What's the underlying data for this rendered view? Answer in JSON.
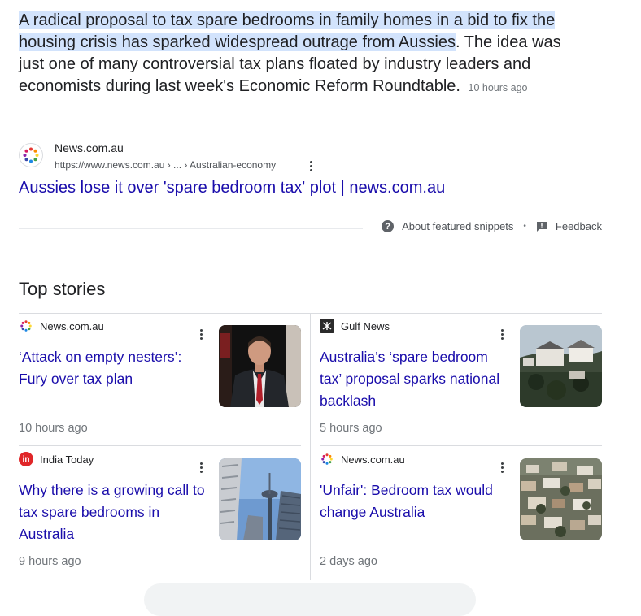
{
  "snippet": {
    "highlighted": "A radical proposal to tax spare bedrooms in family homes in a bid to fix the housing crisis has sparked widespread outrage from Aussies",
    "rest": ". The idea was just one of many controversial tax plans floated by industry leaders and economists during last week's Economic Reform Roundtable.",
    "time": "10 hours ago"
  },
  "source": {
    "name": "News.com.au",
    "url": "https://www.news.com.au › ... › Australian-economy",
    "icon": "newscomau-dots-icon"
  },
  "result_link": "Aussies lose it over 'spare bedroom tax' plot | news.com.au",
  "featured_snippet_bar": {
    "about_label": "About featured snippets",
    "separator": "•",
    "feedback_label": "Feedback"
  },
  "top_stories": {
    "title": "Top stories",
    "cards": [
      {
        "publisher": "News.com.au",
        "headline": "‘Attack on empty nesters’: Fury over tax plan",
        "age": "10 hours ago",
        "thumb": "man-in-suit-photo"
      },
      {
        "publisher": "Gulf News",
        "headline": "Australia’s ‘spare bedroom tax’ proposal sparks national backlash",
        "age": "5 hours ago",
        "thumb": "harbour-houses-photo"
      },
      {
        "publisher": "India Today",
        "publisher_icon_text": "in",
        "headline": "Why there is a growing call to tax spare bedrooms in Australia",
        "age": "9 hours ago",
        "thumb": "city-tower-photo"
      },
      {
        "publisher": "News.com.au",
        "headline": "'Unfair': Bedroom tax would change Australia",
        "age": "2 days ago",
        "thumb": "hillside-houses-photo"
      }
    ]
  },
  "colors": {
    "link": "#1a0dab",
    "highlight": "#d2e3fc",
    "meta": "#70757a"
  }
}
